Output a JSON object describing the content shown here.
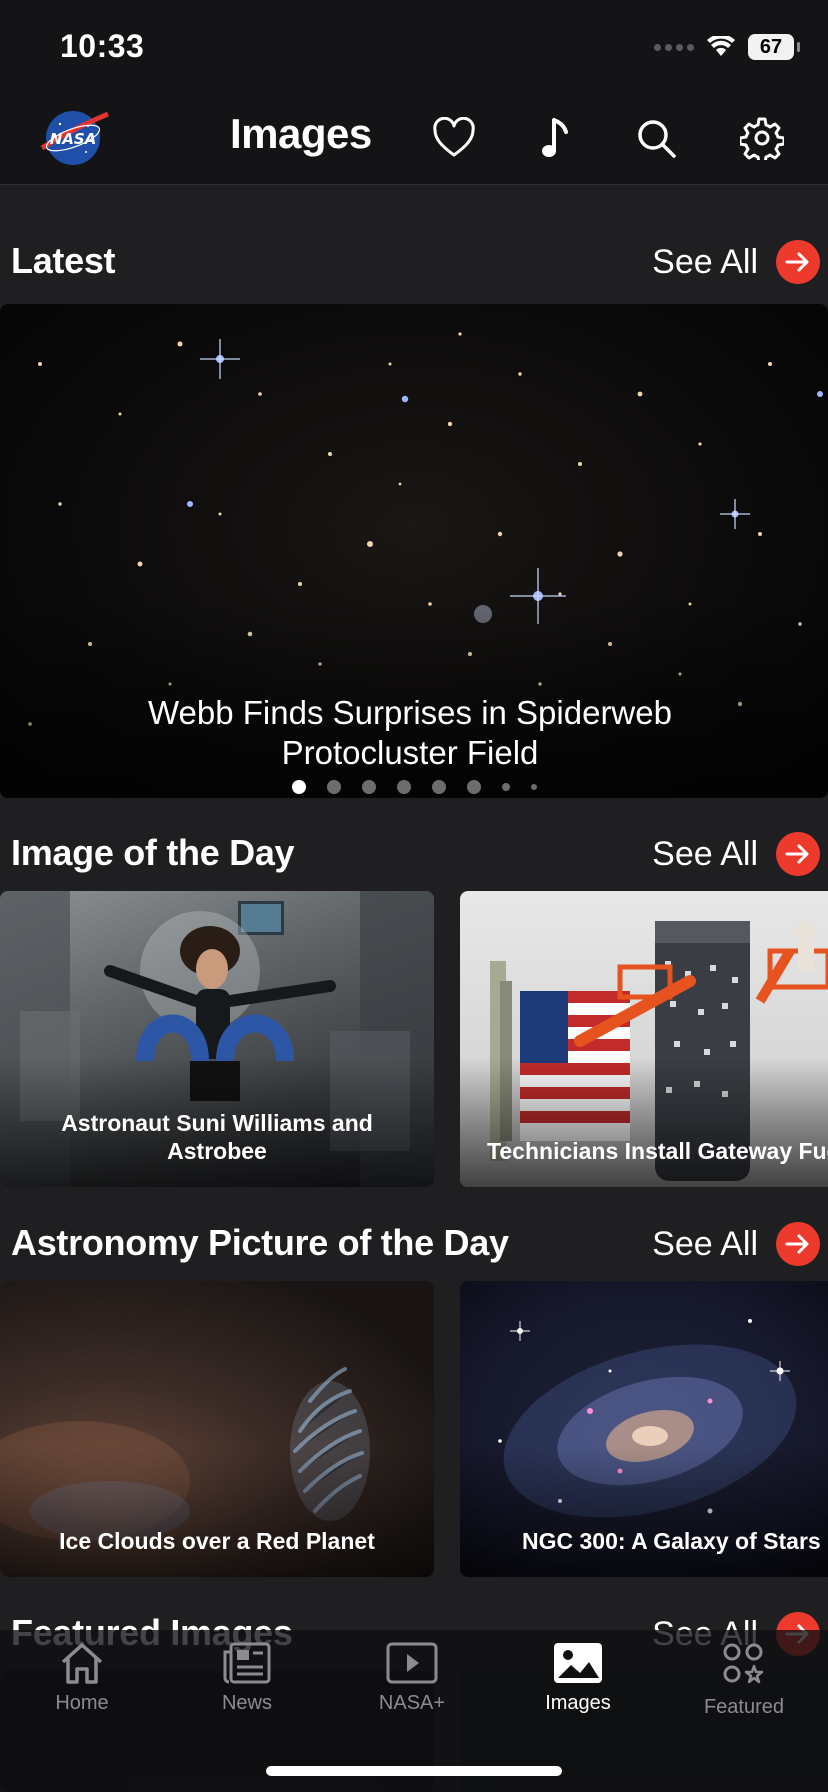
{
  "status_bar": {
    "time": "10:33",
    "battery": "67"
  },
  "header": {
    "title": "Images",
    "logo_icon": "nasa-meatball-logo",
    "actions": [
      "heart-icon",
      "music-note-icon",
      "search-icon",
      "gear-icon"
    ]
  },
  "sections": {
    "latest": {
      "title": "Latest",
      "see_all": "See All",
      "hero_caption": "Webb Finds Surprises in Spiderweb Protocluster Field",
      "page_count": 8,
      "active_page": 1
    },
    "image_of_the_day": {
      "title": "Image of the Day",
      "see_all": "See All",
      "cards": [
        {
          "caption": "Astronaut Suni Williams and Astrobee"
        },
        {
          "caption": "Technicians Install Gateway Fuel Tanks"
        }
      ]
    },
    "apod": {
      "title": "Astronomy Picture of the Day",
      "see_all": "See All",
      "cards": [
        {
          "caption": "Ice Clouds over a Red Planet"
        },
        {
          "caption": "NGC 300: A Galaxy of Stars"
        }
      ]
    },
    "featured": {
      "title": "Featured Images",
      "see_all": "See All"
    }
  },
  "tab_bar": {
    "tabs": [
      {
        "label": "Home",
        "icon": "house-icon"
      },
      {
        "label": "News",
        "icon": "newspaper-icon"
      },
      {
        "label": "NASA+",
        "icon": "play-icon"
      },
      {
        "label": "Images",
        "icon": "photo-icon"
      },
      {
        "label": "Featured",
        "icon": "featured-icon"
      }
    ],
    "active": "Images"
  },
  "colors": {
    "accent": "#ee3a2c",
    "background": "#1f1f21",
    "bar": "#141416"
  }
}
